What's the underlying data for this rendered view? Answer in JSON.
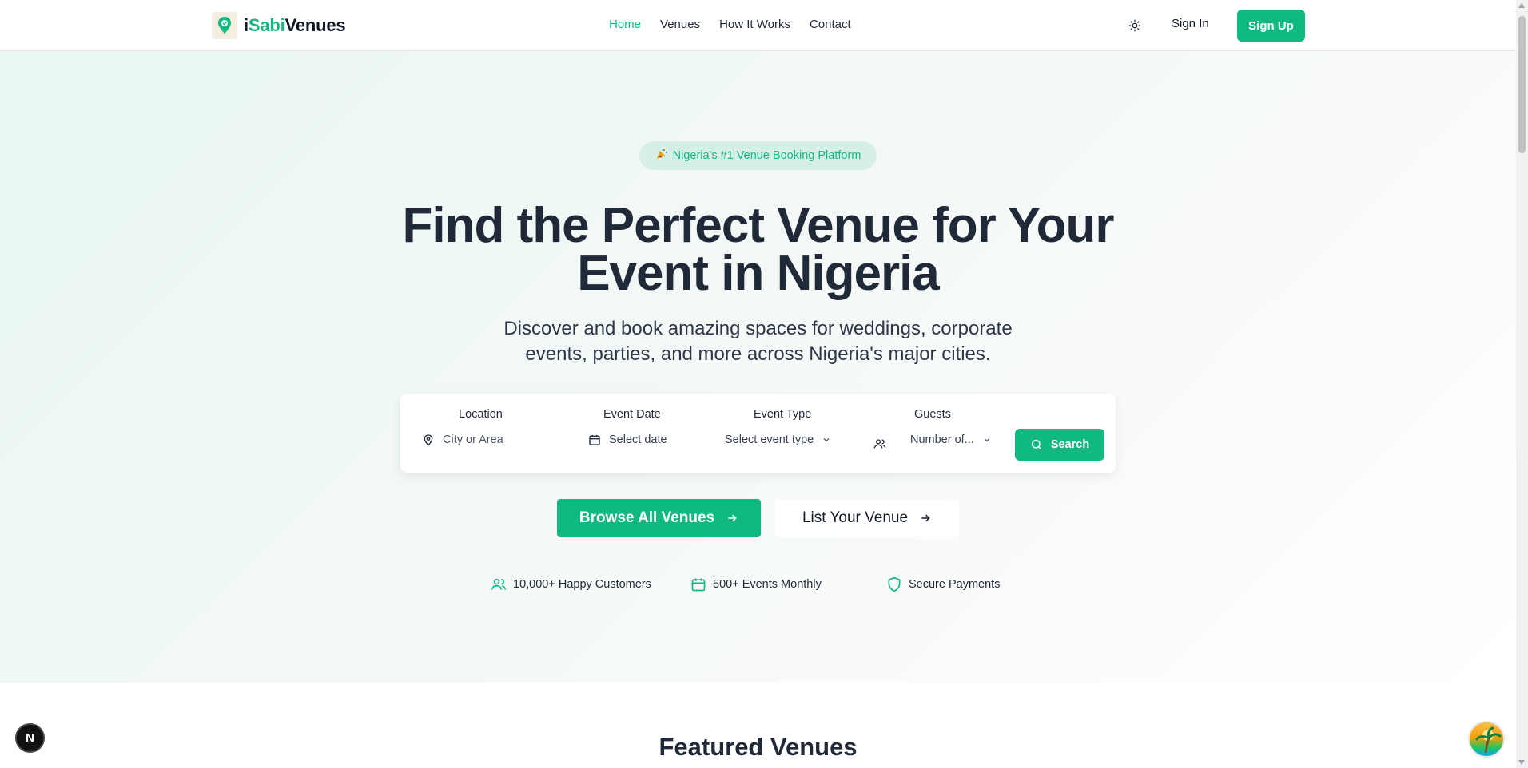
{
  "brand": {
    "prefix": "i",
    "accent": "Sabi",
    "suffix": "Venues",
    "color": "#10b981"
  },
  "nav": {
    "items": [
      {
        "label": "Home",
        "active": true
      },
      {
        "label": "Venues",
        "active": false
      },
      {
        "label": "How It Works",
        "active": false
      },
      {
        "label": "Contact",
        "active": false
      }
    ]
  },
  "header": {
    "theme_icon": "sun-icon",
    "signin_label": "Sign In",
    "signup_label": "Sign Up"
  },
  "hero": {
    "badge": "Nigeria's #1 Venue Booking Platform",
    "title_line1": "Find the Perfect Venue for Your",
    "title_line2": "Event in Nigeria",
    "subtitle_line1": "Discover and book amazing spaces for weddings, corporate",
    "subtitle_line2": "events, parties, and more across Nigeria's major cities."
  },
  "search": {
    "location_label": "Location",
    "location_placeholder": "City or Area",
    "date_label": "Event Date",
    "date_placeholder": "Select date",
    "type_label": "Event Type",
    "type_value": "Select event type",
    "guests_label": "Guests",
    "guests_value": "Number of...",
    "button_label": "Search"
  },
  "cta": {
    "browse_label": "Browse All Venues",
    "list_label": "List Your Venue"
  },
  "stats": [
    {
      "label": "10,000+ Happy Customers",
      "icon": "users-icon"
    },
    {
      "label": "500+ Events Monthly",
      "icon": "calendar-icon"
    },
    {
      "label": "Secure Payments",
      "icon": "shield-icon"
    }
  ],
  "featured": {
    "title": "Featured Venues"
  },
  "floating": {
    "next_badge": "N"
  }
}
